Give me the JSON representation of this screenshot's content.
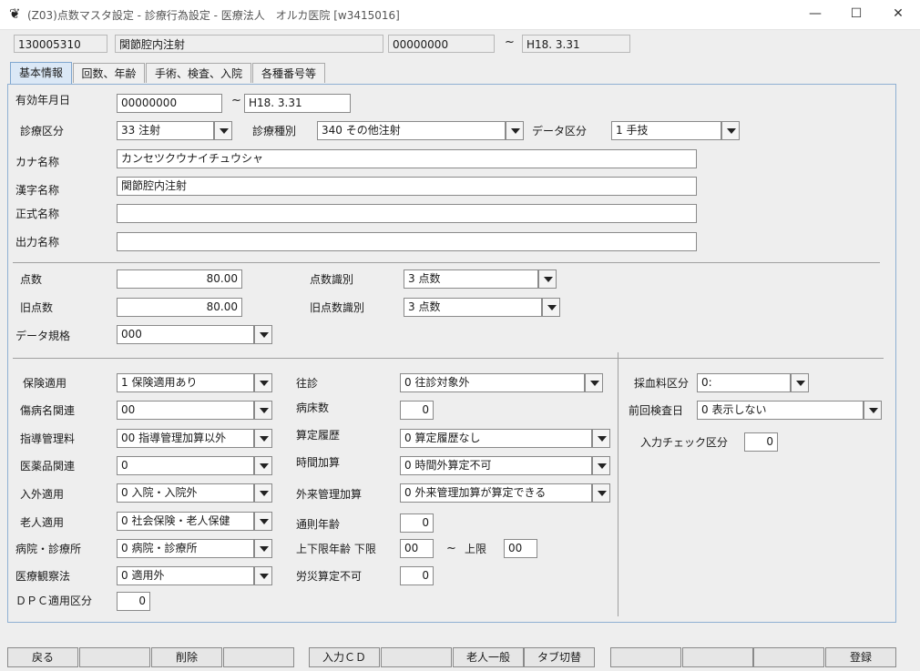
{
  "window": {
    "title": "(Z03)点数マスタ設定 - 診療行為設定 - 医療法人　オルカ医院  [w3415016]",
    "minimize": "—",
    "maximize": "☐",
    "close": "✕"
  },
  "header": {
    "code": "130005310",
    "name": "関節腔内注射",
    "start_date": "00000000",
    "tilde": "~",
    "end_date": "H18. 3.31"
  },
  "tabs": [
    "基本情報",
    "回数、年齢",
    "手術、検査、入院",
    "各種番号等"
  ],
  "basic": {
    "valid_period_label": "有効年月日",
    "valid_from": "00000000",
    "tilde": "~",
    "valid_to": "H18. 3.31",
    "shinryo_kubun_label": "診療区分",
    "shinryo_kubun": "33 注射",
    "shinryo_shubetsu_label": "診療種別",
    "shinryo_shubetsu": "340 その他注射",
    "data_kubun_label": "データ区分",
    "data_kubun": "1 手技",
    "kana_label": "カナ名称",
    "kana": "カンセツクウナイチュウシャ",
    "kanji_label": "漢字名称",
    "kanji": "関節腔内注射",
    "formal_label": "正式名称",
    "formal": "",
    "output_label": "出力名称",
    "output": ""
  },
  "points": {
    "tensu_label": "点数",
    "tensu": "80.00",
    "tensu_shikibetsu_label": "点数識別",
    "tensu_shikibetsu": "3 点数",
    "old_tensu_label": "旧点数",
    "old_tensu": "80.00",
    "old_shikibetsu_label": "旧点数識別",
    "old_shikibetsu": "3 点数",
    "data_kikaku_label": "データ規格",
    "data_kikaku": "000"
  },
  "left_col": [
    {
      "label": "保険適用",
      "value": "1 保険適用あり"
    },
    {
      "label": "傷病名関連",
      "value": "00"
    },
    {
      "label": "指導管理料",
      "value": "00 指導管理加算以外"
    },
    {
      "label": "医薬品関連",
      "value": "0"
    },
    {
      "label": "入外適用",
      "value": "0 入院・入院外"
    },
    {
      "label": "老人適用",
      "value": "0 社会保険・老人保健"
    },
    {
      "label": "病院・診療所",
      "value": "0 病院・診療所"
    },
    {
      "label": "医療観察法",
      "value": "0 適用外"
    }
  ],
  "dpc": {
    "label": "ＤＰＣ適用区分",
    "value": "0"
  },
  "mid_col": {
    "oshin_label": "往診",
    "oshin": "0 往診対象外",
    "byosho_label": "病床数",
    "byosho": "0",
    "santei_label": "算定履歴",
    "santei": "0 算定履歴なし",
    "jikan_label": "時間加算",
    "jikan": "0 時間外算定不可",
    "gairai_label": "外来管理加算",
    "gairai": "0 外来管理加算が算定できる",
    "tsusoku_label": "通則年齢",
    "tsusoku": "0",
    "joge_label": "上下限年齢 下限",
    "kagen": "00",
    "tilde": "~",
    "jogen_label": "上限",
    "jogen": "00",
    "rosai_label": "労災算定不可",
    "rosai": "0"
  },
  "right_col": {
    "saiketsu_label": "採血料区分",
    "saiketsu": "0:",
    "zenkai_label": "前回検査日",
    "zenkai": "0 表示しない",
    "check_label": "入力チェック区分",
    "check": "0"
  },
  "footer": [
    "戻る",
    "",
    "削除",
    "",
    "入力ＣＤ",
    "",
    "老人一般",
    "タブ切替",
    "",
    "",
    "",
    "登録"
  ]
}
